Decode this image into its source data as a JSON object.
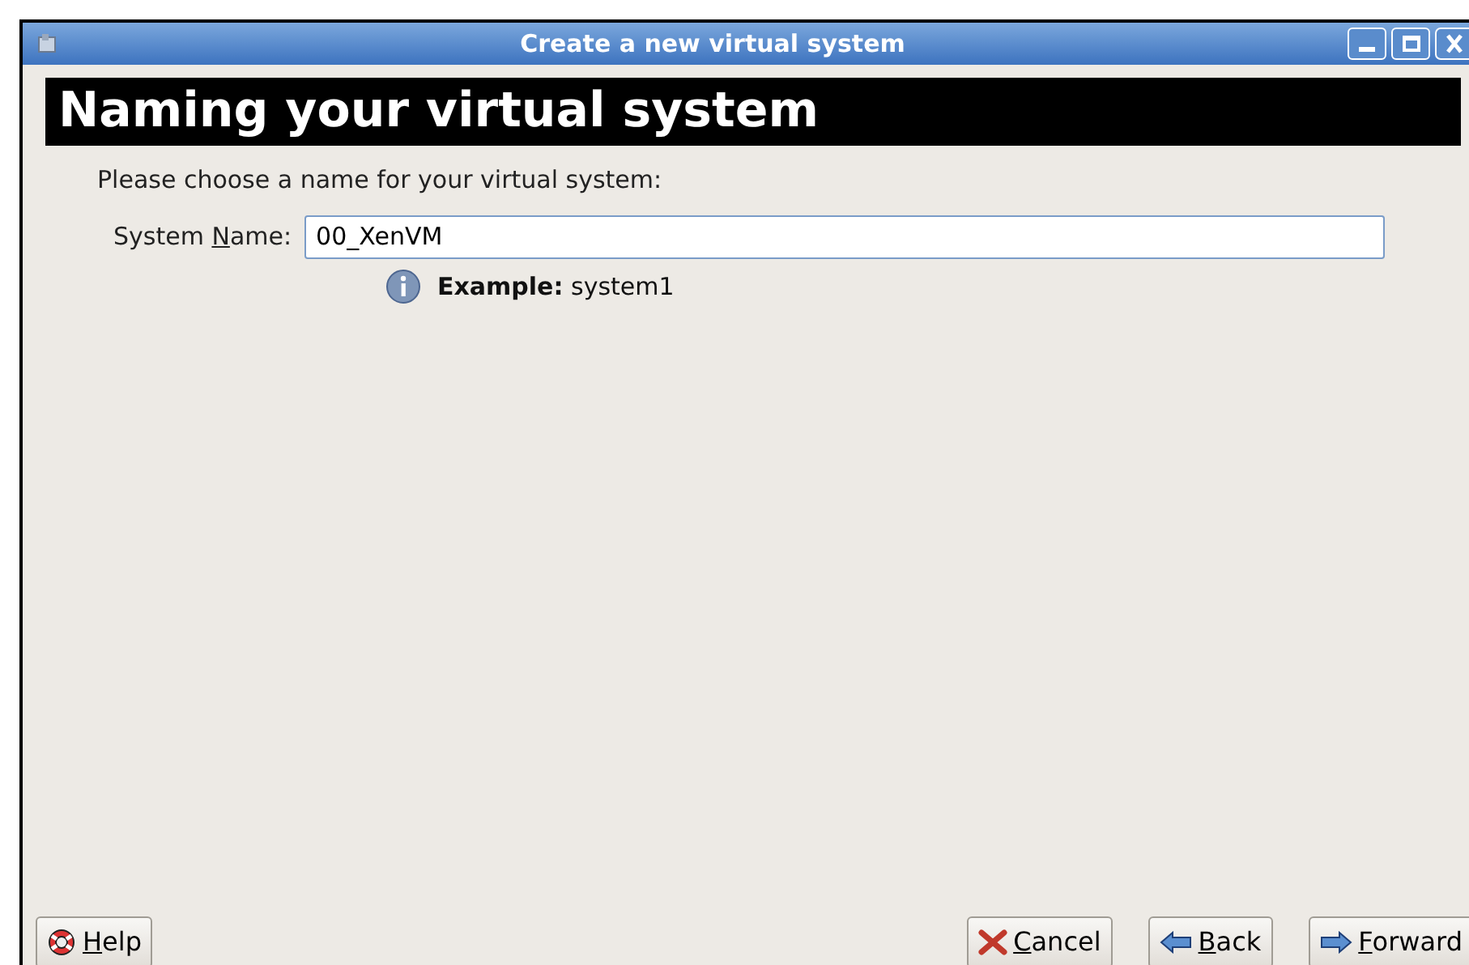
{
  "window": {
    "title": "Create a new virtual system"
  },
  "header": {
    "title": "Naming your virtual system"
  },
  "prompt": "Please choose a name for your virtual system:",
  "name_field": {
    "label": {
      "before": "System ",
      "key": "N",
      "after": "ame:"
    },
    "value": "00_XenVM"
  },
  "hint": {
    "label": "Example:",
    "text": "system1"
  },
  "buttons": [
    {
      "kind": "help",
      "label": {
        "key": "H",
        "after": "elp"
      }
    },
    {
      "kind": "cancel",
      "label": {
        "key": "C",
        "after": "ancel"
      }
    },
    {
      "kind": "back",
      "label": {
        "key": "B",
        "after": "ack"
      }
    },
    {
      "kind": "forward",
      "label": {
        "key": "F",
        "after": "orward"
      }
    }
  ]
}
